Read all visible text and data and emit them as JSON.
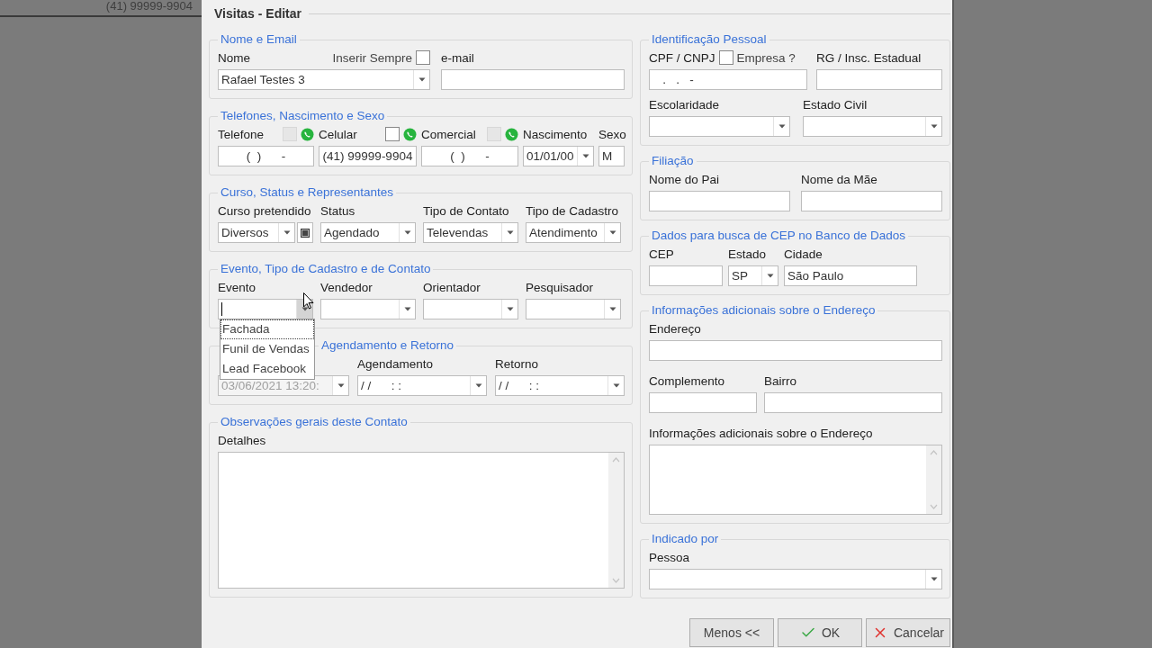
{
  "background": {
    "phone": "(41) 99999-9904"
  },
  "dialog": {
    "title": "Visitas - Editar"
  },
  "left_groups": [
    {
      "title": "Nome e Email",
      "rows": [
        [
          {
            "kind": "combo",
            "label": "Nome",
            "value": "Rafael Testes 3",
            "option": {
              "kind": "text_before",
              "label": "Inserir Sempre",
              "checked": false
            }
          },
          {
            "kind": "text",
            "label": "e-mail"
          }
        ]
      ]
    },
    {
      "title": "Telefones, Nascimento e Sexo",
      "rows": [
        [
          {
            "kind": "masked",
            "label": "Telefone",
            "value": "(  )      -",
            "whatsapp": {
              "checked": false,
              "disabled": true
            }
          },
          {
            "kind": "masked",
            "label": "Celular",
            "value": "(41) 99999-9904",
            "whatsapp": {
              "checked": false,
              "disabled": false
            }
          },
          {
            "kind": "masked",
            "label": "Comercial",
            "value": "(  )      -",
            "whatsapp": {
              "checked": false,
              "disabled": true
            }
          },
          {
            "kind": "combo",
            "label": "Nascimento",
            "value": "01/01/00"
          },
          {
            "kind": "text",
            "label": "Sexo",
            "value": "M"
          }
        ]
      ]
    },
    {
      "title": "Curso, Status e Representantes",
      "rows": [
        [
          {
            "kind": "combo",
            "label": "Curso pretendido",
            "value": "Diversos",
            "extra_button": true
          },
          {
            "kind": "combo",
            "label": "Status",
            "value": "Agendado"
          },
          {
            "kind": "combo",
            "label": "Tipo de Contato",
            "value": "Televendas"
          },
          {
            "kind": "combo",
            "label": "Tipo de Cadastro",
            "value": "Atendimento"
          }
        ]
      ]
    },
    {
      "title": "Evento, Tipo de Cadastro e de Contato",
      "rows": [
        [
          {
            "kind": "combo",
            "label": "Evento",
            "open": true,
            "options": [
              {
                "label": "Fachada",
                "selected": true
              },
              {
                "label": "Funil de Vendas",
                "selected": false
              },
              {
                "label": "Lead Facebook",
                "selected": false
              }
            ]
          },
          {
            "kind": "combo",
            "label": "Vendedor"
          },
          {
            "kind": "combo",
            "label": "Orientador"
          },
          {
            "kind": "combo",
            "label": "Pesquisador"
          }
        ]
      ]
    },
    {
      "title": "Agendamento e Retorno",
      "rows": [
        [
          {
            "kind": "combo",
            "value": "03/06/2021 13:20:",
            "disabled": true
          },
          {
            "kind": "combo",
            "label": "Agendamento",
            "value": "/ /      : :"
          },
          {
            "kind": "combo",
            "label": "Retorno",
            "value": "/ /      : :"
          }
        ]
      ]
    },
    {
      "title": "Observações gerais deste Contato",
      "rows": [
        [
          {
            "kind": "textarea",
            "label": "Detalhes"
          }
        ]
      ]
    }
  ],
  "right_groups": [
    {
      "title": "Identificação Pessoal",
      "rows": [
        [
          {
            "kind": "text",
            "label": "CPF / CNPJ",
            "value": "   .   .   -",
            "option": {
              "kind": "box_before",
              "label": "Empresa ?",
              "checked": false
            }
          },
          {
            "kind": "text",
            "label": "RG / Insc. Estadual"
          }
        ],
        [
          {
            "kind": "combo",
            "label": "Escolaridade"
          },
          {
            "kind": "combo",
            "label": "Estado Civil"
          }
        ]
      ]
    },
    {
      "title": "Filiação",
      "rows": [
        [
          {
            "kind": "text",
            "label": "Nome do Pai"
          },
          {
            "kind": "text",
            "label": "Nome da Mãe"
          }
        ]
      ]
    },
    {
      "title": "Dados para busca de CEP no Banco de Dados",
      "rows": [
        [
          {
            "kind": "text",
            "label": "CEP"
          },
          {
            "kind": "combo",
            "label": "Estado",
            "value": "SP"
          },
          {
            "kind": "text",
            "label": "Cidade",
            "value": "São Paulo"
          }
        ]
      ]
    },
    {
      "title": "Informações adicionais sobre o Endereço",
      "rows": [
        [
          {
            "kind": "text",
            "label": "Endereço"
          }
        ],
        [
          {
            "kind": "text",
            "label": "Complemento"
          },
          {
            "kind": "text",
            "label": "Bairro"
          }
        ],
        [
          {
            "kind": "textarea",
            "label": "Informações adicionais sobre o Endereço"
          }
        ]
      ]
    },
    {
      "title": "Indicado por",
      "rows": [
        [
          {
            "kind": "combo",
            "label": "Pessoa"
          }
        ]
      ]
    }
  ],
  "buttons": [
    {
      "kind": "plain",
      "label": "Menos <<"
    },
    {
      "kind": "ok",
      "label": "OK"
    },
    {
      "kind": "cancel",
      "label": "Cancelar"
    }
  ]
}
